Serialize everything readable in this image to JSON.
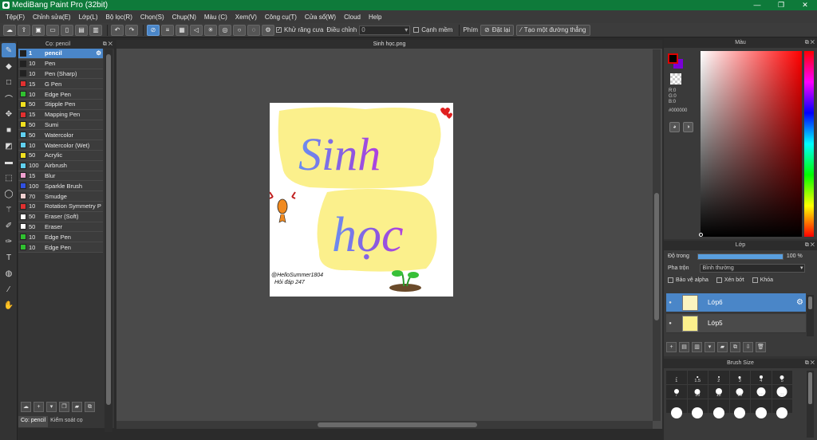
{
  "window": {
    "title": "MediBang Paint Pro (32bit)",
    "controls": [
      "—",
      "❐",
      "✕"
    ]
  },
  "menu": [
    "Tệp(F)",
    "Chỉnh sửa(E)",
    "Lớp(L)",
    "Bộ lọc(R)",
    "Chọn(S)",
    "Chụp(N)",
    "Màu (C)",
    "Xem(V)",
    "Công cụ(T)",
    "Cửa sổ(W)",
    "Cloud",
    "Help"
  ],
  "toolbar": {
    "antialias_label": "Khử răng cưa",
    "adjust_label": "Điều chỉnh",
    "adjust_value": "0",
    "edge_label": "Cạnh mềm",
    "keys_label": "Phím",
    "reset_label": "Đặt lại",
    "make_line_label": "Tạo một đường thẳng"
  },
  "brush_panel": {
    "title": "Cọ: pencil",
    "brushes": [
      {
        "size": "1",
        "name": "pencil",
        "color": "#222222"
      },
      {
        "size": "10",
        "name": "Pen",
        "color": "#222222"
      },
      {
        "size": "10",
        "name": "Pen (Sharp)",
        "color": "#222222"
      },
      {
        "size": "15",
        "name": "G Pen",
        "color": "#e03030"
      },
      {
        "size": "10",
        "name": "Edge Pen",
        "color": "#30c030"
      },
      {
        "size": "50",
        "name": "Stipple Pen",
        "color": "#f0e020"
      },
      {
        "size": "15",
        "name": "Mapping Pen",
        "color": "#e03030"
      },
      {
        "size": "50",
        "name": "Sumi",
        "color": "#f0e020"
      },
      {
        "size": "50",
        "name": "Watercolor",
        "color": "#60d0f0"
      },
      {
        "size": "10",
        "name": "Watercolor (Wet)",
        "color": "#60d0f0"
      },
      {
        "size": "50",
        "name": "Acrylic",
        "color": "#f0e020"
      },
      {
        "size": "100",
        "name": "Airbrush",
        "color": "#60d0f0"
      },
      {
        "size": "15",
        "name": "Blur",
        "color": "#f0a0d0"
      },
      {
        "size": "100",
        "name": "Sparkle Brush",
        "color": "#3050e0"
      },
      {
        "size": "70",
        "name": "Smudge",
        "color": "#f0d0d0"
      },
      {
        "size": "10",
        "name": "Rotation Symmetry P",
        "color": "#e03030"
      },
      {
        "size": "50",
        "name": "Eraser (Soft)",
        "color": "#ffffff"
      },
      {
        "size": "50",
        "name": "Eraser",
        "color": "#ffffff"
      },
      {
        "size": "10",
        "name": "Edge Pen",
        "color": "#30c030"
      },
      {
        "size": "10",
        "name": "Edge Pen",
        "color": "#30c030"
      }
    ],
    "tabs": [
      "Cọ: pencil",
      "Kiểm soát cọ"
    ]
  },
  "canvas": {
    "doc_title": "Sinh học.png",
    "art_word_1": "Sinh",
    "art_word_2": "học",
    "signature_line_1": "@HelloSummer1804",
    "signature_line_2": "Hỏi đáp 247"
  },
  "color_panel": {
    "title": "Màu",
    "fg_color": "#000000",
    "bg_color": "#7a00d8",
    "rgb": [
      "R:0",
      "G:0",
      "B:0"
    ],
    "hex": "#000000"
  },
  "layer_panel": {
    "title": "Lớp",
    "opacity_label": "Độ trong",
    "opacity_value": "100 %",
    "opacity": 1.0,
    "blend_label": "Pha trộn",
    "blend_value": "Bình thường",
    "protect_alpha": "Bảo vệ alpha",
    "clipping": "Xén bớt",
    "lock": "Khóa",
    "layers": [
      {
        "name": "Lớp6",
        "active": true
      },
      {
        "name": "Lớp5",
        "active": false
      }
    ]
  },
  "brush_size_panel": {
    "title": "Brush Size",
    "sizes": [
      "1",
      "1.5",
      "2",
      "3",
      "4",
      "5",
      "7",
      "10",
      "12",
      "15",
      "20",
      "25",
      "",
      "",
      "",
      "",
      "",
      ""
    ]
  }
}
